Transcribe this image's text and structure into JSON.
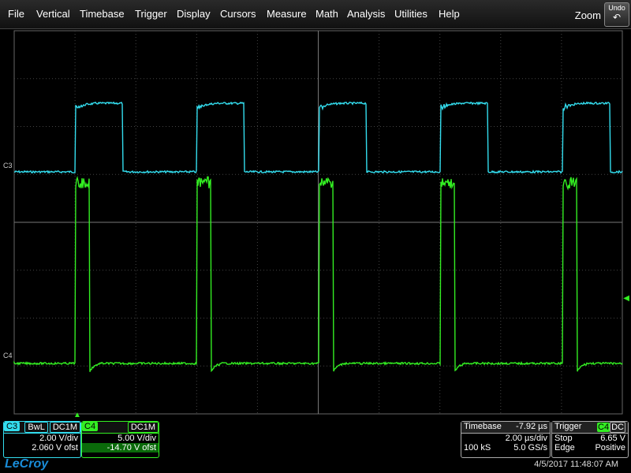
{
  "menu": [
    "File",
    "Vertical",
    "Timebase",
    "Trigger",
    "Display",
    "Cursors",
    "Measure",
    "Math",
    "Analysis",
    "Utilities",
    "Help"
  ],
  "zoom_label": "Zoom",
  "undo_label": "Undo",
  "channels": {
    "c3": {
      "name": "C3",
      "color": "#33ddee",
      "badges": [
        "BwL",
        "DC1M"
      ],
      "vdiv": "2.00 V/div",
      "offset": "2.060 V ofst"
    },
    "c4": {
      "name": "C4",
      "color": "#33ee22",
      "badges": [
        "DC1M"
      ],
      "vdiv": "5.00 V/div",
      "offset": "-14.70 V ofst"
    }
  },
  "timebase": {
    "title": "Timebase",
    "delay": "-7.92 µs",
    "tdiv": "2.00 µs/div",
    "samples": "100 kS",
    "rate": "5.0 GS/s"
  },
  "trigger": {
    "title": "Trigger",
    "source": "C4",
    "coupling": "DC",
    "mode": "Stop",
    "level": "6.65 V",
    "type": "Edge",
    "slope": "Positive"
  },
  "brand": "LeCroy",
  "datetime": "4/5/2017 11:48:07 AM"
}
